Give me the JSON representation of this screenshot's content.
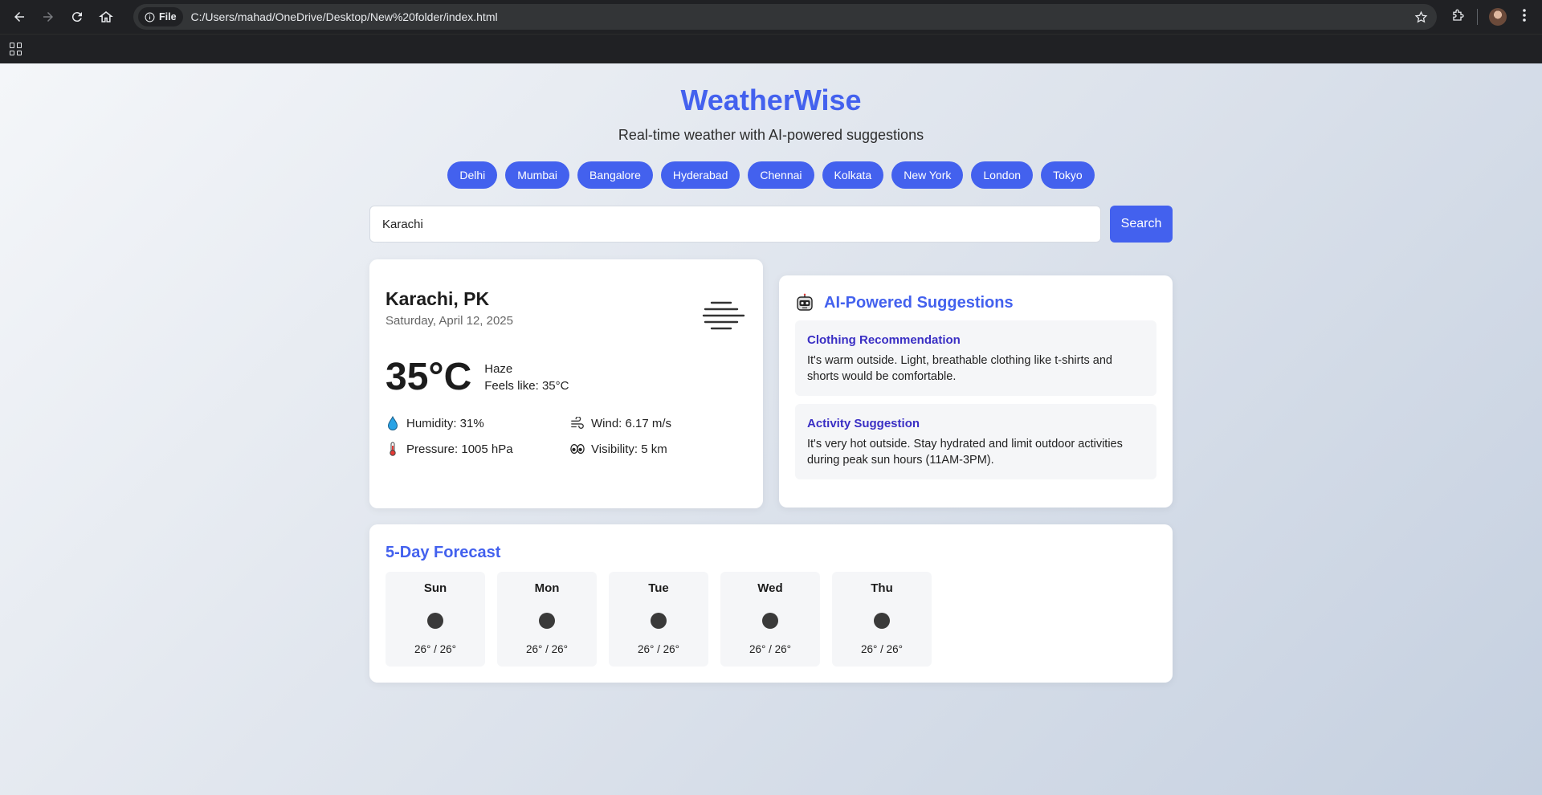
{
  "browser": {
    "file_label": "File",
    "url": "C:/Users/mahad/OneDrive/Desktop/New%20folder/index.html"
  },
  "app": {
    "title": "WeatherWise",
    "subtitle": "Real-time weather with AI-powered suggestions"
  },
  "cities": [
    "Delhi",
    "Mumbai",
    "Bangalore",
    "Hyderabad",
    "Chennai",
    "Kolkata",
    "New York",
    "London",
    "Tokyo"
  ],
  "search": {
    "value": "Karachi",
    "button_label": "Search"
  },
  "current": {
    "location": "Karachi, PK",
    "date": "Saturday, April 12, 2025",
    "temperature": "35°C",
    "condition": "Haze",
    "feels_like": "Feels like: 35°C",
    "condition_icon": "haze-icon",
    "humidity": "Humidity: 31%",
    "wind": "Wind: 6.17 m/s",
    "pressure": "Pressure: 1005 hPa",
    "visibility": "Visibility: 5 km"
  },
  "suggestions": {
    "title": "AI-Powered Suggestions",
    "header_icon": "robot-icon",
    "items": [
      {
        "title": "Clothing Recommendation",
        "text": "It's warm outside. Light, breathable clothing like t-shirts and shorts would be comfortable."
      },
      {
        "title": "Activity Suggestion",
        "text": "It's very hot outside. Stay hydrated and limit outdoor activities during peak sun hours (11AM-3PM)."
      }
    ]
  },
  "forecast": {
    "title": "5-Day Forecast",
    "days": [
      {
        "day": "Sun",
        "temps": "26° / 26°"
      },
      {
        "day": "Mon",
        "temps": "26° / 26°"
      },
      {
        "day": "Tue",
        "temps": "26° / 26°"
      },
      {
        "day": "Wed",
        "temps": "26° / 26°"
      },
      {
        "day": "Thu",
        "temps": "26° / 26°"
      }
    ]
  },
  "colors": {
    "accent": "#4361ee",
    "suggestion_title": "#3a2fc4"
  }
}
